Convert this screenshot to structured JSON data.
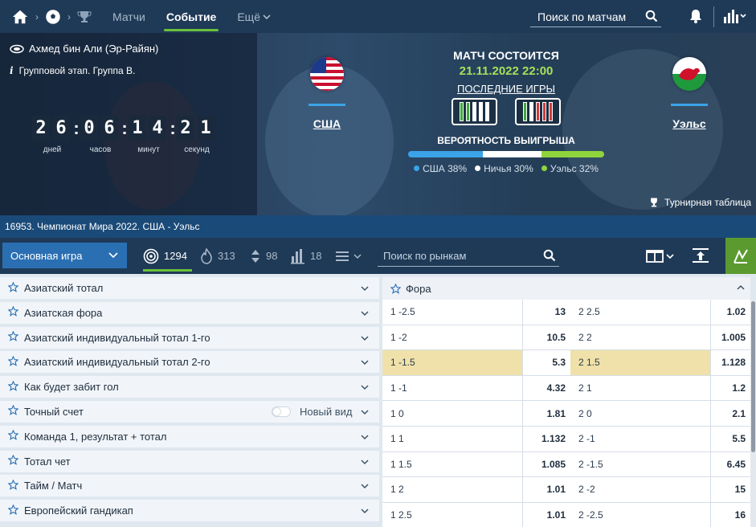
{
  "topnav": {
    "tabs": [
      "Матчи",
      "Событие",
      "Ещё"
    ],
    "active_tab": "Событие",
    "search_placeholder": "Поиск по матчам"
  },
  "hero": {
    "stadium": "Ахмед бин Али (Эр-Райян)",
    "stage": "Групповой этап. Группа B.",
    "timer": {
      "days": "26",
      "hours": "06",
      "minutes": "14",
      "seconds": "21",
      "labels": [
        "дней",
        "часов",
        "минут",
        "секунд"
      ]
    },
    "team1": "США",
    "team2": "Уэльс",
    "status": "МАТЧ СОСТОИТСЯ",
    "date": "21.11.2022 22:00",
    "last_games": "ПОСЛЕДНИЕ ИГРЫ",
    "form1": [
      "win",
      "win",
      "draw",
      "draw",
      "draw"
    ],
    "form2": [
      "win",
      "draw",
      "loss",
      "loss",
      "loss"
    ],
    "prob_title": "ВЕРОЯТНОСТЬ ВЫИГРЫША",
    "probabilities": [
      {
        "label": "США 38%",
        "value": 38,
        "color": "#3ba3e8"
      },
      {
        "label": "Ничья 30%",
        "value": 30,
        "color": "#ffffff"
      },
      {
        "label": "Уэльс 32%",
        "value": 32,
        "color": "#8fd43c"
      }
    ],
    "tournament_table": "Турнирная таблица"
  },
  "match_title": "16953. Чемпионат Мира 2022. США - Уэльс",
  "filter": {
    "selected_market_group": "Основная игра",
    "counts": [
      {
        "icon": "target-icon",
        "value": "1294"
      },
      {
        "icon": "fire-icon",
        "value": "313"
      },
      {
        "icon": "updown-icon",
        "value": "98"
      },
      {
        "icon": "bars-icon",
        "value": "18"
      }
    ],
    "market_search_placeholder": "Поиск по рынкам"
  },
  "markets": [
    "Азиатский тотал",
    "Азиатская фора",
    "Азиатский индивидуальный тотал 1-го",
    "Азиатский индивидуальный тотал 2-го",
    "Как будет забит гол",
    "Точный счет",
    "Команда 1, результат + тотал",
    "Тотал чет",
    "Тайм / Матч",
    "Европейский гандикап"
  ],
  "new_view_label": "Новый вид",
  "fora": {
    "title": "Фора",
    "rows": [
      {
        "l1": "1 -2.5",
        "o1": "13",
        "l2": "2 2.5",
        "o2": "1.02"
      },
      {
        "l1": "1 -2",
        "o1": "10.5",
        "l2": "2 2",
        "o2": "1.005"
      },
      {
        "l1": "1 -1.5",
        "o1": "5.3",
        "l2": "2 1.5",
        "o2": "1.128"
      },
      {
        "l1": "1 -1",
        "o1": "4.32",
        "l2": "2 1",
        "o2": "1.2"
      },
      {
        "l1": "1 0",
        "o1": "1.81",
        "l2": "2 0",
        "o2": "2.1"
      },
      {
        "l1": "1 1",
        "o1": "1.132",
        "l2": "2 -1",
        "o2": "5.5"
      },
      {
        "l1": "1 1.5",
        "o1": "1.085",
        "l2": "2 -1.5",
        "o2": "6.45"
      },
      {
        "l1": "1 2",
        "o1": "1.01",
        "l2": "2 -2",
        "o2": "15"
      },
      {
        "l1": "1 2.5",
        "o1": "1.01",
        "l2": "2 -2.5",
        "o2": "16"
      }
    ],
    "highlighted_row": 2
  }
}
